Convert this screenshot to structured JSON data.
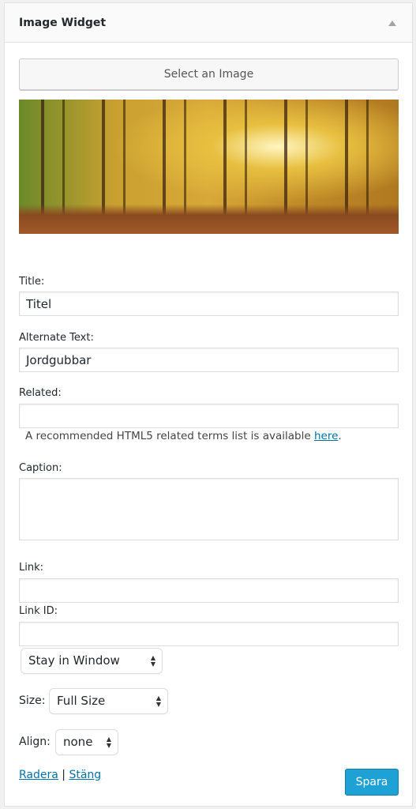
{
  "widget": {
    "title": "Image Widget"
  },
  "select_image_label": "Select an Image",
  "fields": {
    "title_label": "Title:",
    "title_value": "Titel",
    "alt_label": "Alternate Text:",
    "alt_value": "Jordgubbar",
    "related_label": "Related:",
    "related_value": "",
    "related_help": "A recommended HTML5 related terms list is available ",
    "related_help_link": "here",
    "related_help_end": ".",
    "caption_label": "Caption:",
    "caption_value": "",
    "link_label": "Link:",
    "link_value": "",
    "linkid_label": "Link ID:",
    "linkid_value": "",
    "link_target": "Stay in Window",
    "size_label": "Size:",
    "size_value": "Full Size",
    "align_label": "Align:",
    "align_value": "none"
  },
  "footer": {
    "delete": "Radera",
    "sep": "|",
    "close": "Stäng",
    "save": "Spara"
  },
  "colors": {
    "accent": "#1ea1d4",
    "link": "#0073aa"
  }
}
